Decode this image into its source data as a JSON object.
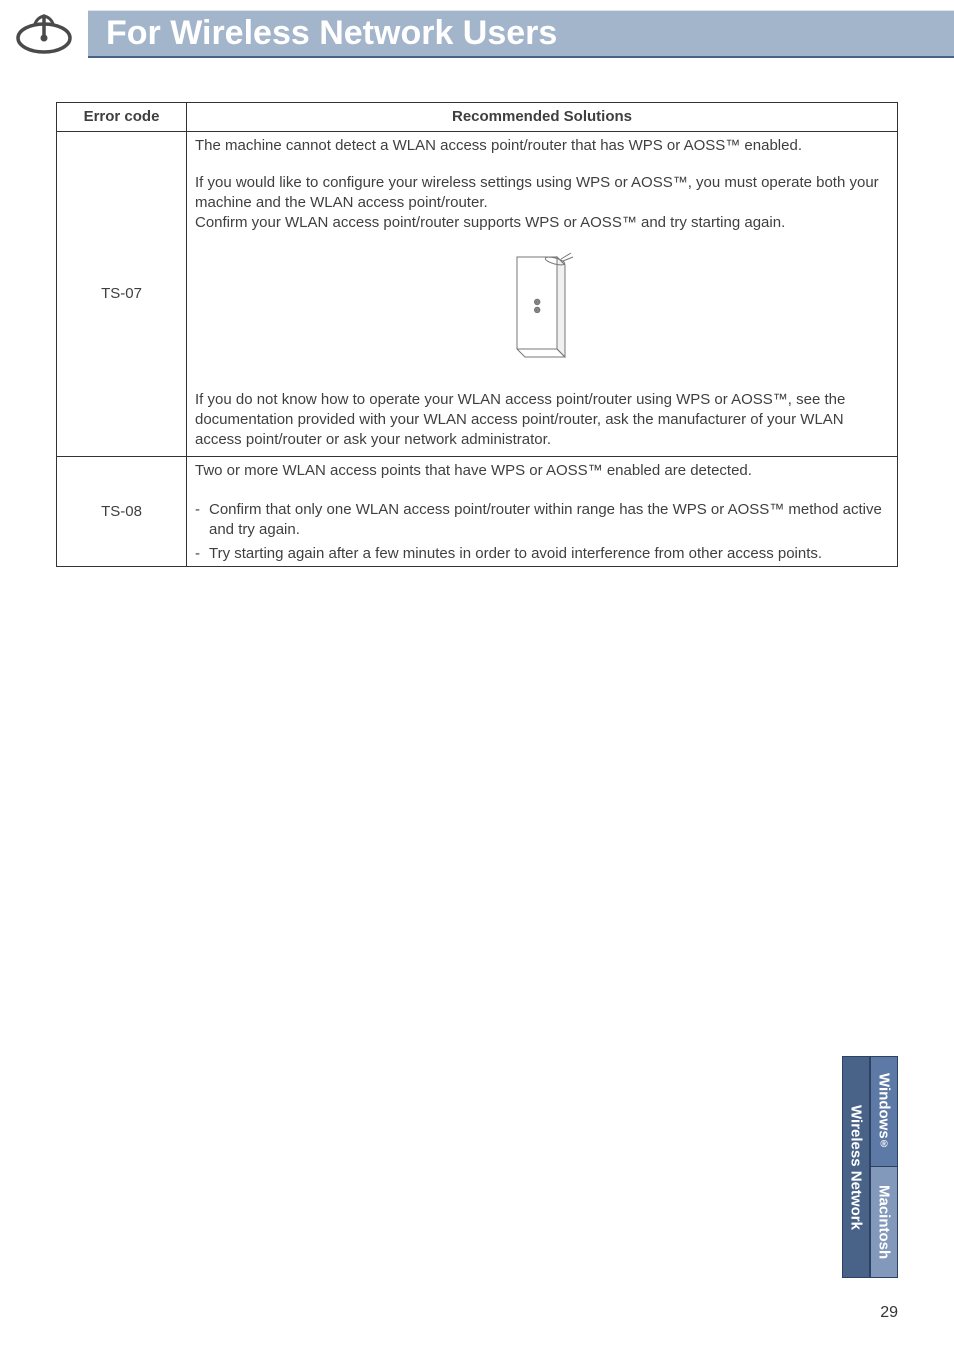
{
  "header": {
    "title": "For Wireless Network Users"
  },
  "table": {
    "col1": "Error code",
    "col2": "Recommended Solutions",
    "rows": [
      {
        "code": "TS-07",
        "p1": "The machine cannot detect a WLAN access point/router that has WPS or AOSS™ enabled.",
        "p2a": "If you would like to configure your wireless settings using WPS or AOSS™, you must operate both your machine and the WLAN access point/router.",
        "p2b": "Confirm your WLAN access point/router supports WPS or AOSS™ and try starting again.",
        "p3": "If you do not know how to operate your WLAN access point/router using WPS or AOSS™, see the documentation provided with your WLAN access point/router, ask the manufacturer of your WLAN access point/router or ask your network administrator."
      },
      {
        "code": "TS-08",
        "p1": "Two or more WLAN access points that have WPS or AOSS™ enabled are detected.",
        "b1": "Confirm that only one WLAN access point/router within range has the WPS or AOSS™ method active and try again.",
        "b2": "Try starting again after a few minutes in order to avoid interference from other access points."
      }
    ]
  },
  "tabs": {
    "wireless": "Wireless Network",
    "windows": "Windows",
    "mac": "Macintosh"
  },
  "page": "29"
}
